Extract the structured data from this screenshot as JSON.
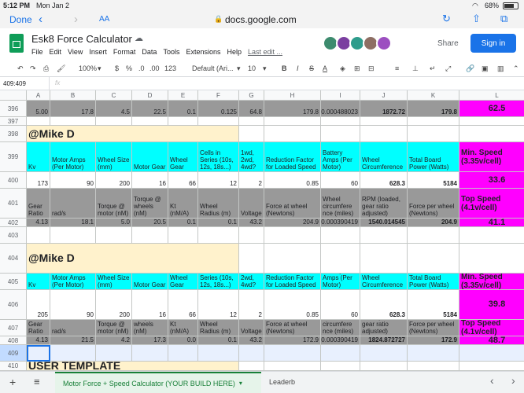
{
  "status": {
    "time": "5:12 PM",
    "date": "Mon Jan 2",
    "battery": "68%"
  },
  "safari": {
    "done": "Done",
    "text_size": "AA",
    "url": "docs.google.com"
  },
  "doc": {
    "title": "Esk8 Force Calculator",
    "menu": [
      "File",
      "Edit",
      "View",
      "Insert",
      "Format",
      "Data",
      "Tools",
      "Extensions",
      "Help"
    ],
    "last_edit": "Last edit ...",
    "share": "Share",
    "sign_in": "Sign in"
  },
  "toolbar": {
    "zoom": "100%",
    "currency": "$",
    "percent": "%",
    "dec_less": ".0",
    "dec_more": ".00",
    "format_more": "123",
    "font": "Default (Ari...",
    "font_size": "10",
    "bold": "B",
    "italic": "I",
    "strike": "S",
    "text_color": "A"
  },
  "formula_bar": {
    "name_box": "409:409",
    "fx": "fx"
  },
  "grid": {
    "columns": [
      "A",
      "B",
      "C",
      "D",
      "E",
      "F",
      "G",
      "H",
      "I",
      "J",
      "K",
      "L"
    ],
    "row_nums": [
      "396",
      "397",
      "398",
      "399",
      "400",
      "401",
      "402",
      "403",
      "404",
      "405",
      "406",
      "407",
      "408",
      "409",
      "410"
    ],
    "r396": [
      "5.00",
      "17.8",
      "4.5",
      "22.5",
      "0.1",
      "0.125",
      "64.8",
      "179.8",
      "0.000488023",
      "1872.72",
      "179.8",
      "62.5"
    ],
    "name1": "@Mike D",
    "name2": "@Mike D",
    "template": "USER TEMPLATE",
    "hdr_a": [
      "Kv",
      "Motor Amps (Per Motor)",
      "Wheel Size (mm)",
      "Motor Gear",
      "Wheel Gear",
      "Cells in Series (10s, 12s, 18s...)",
      "1wd, 2wd, 4wd?",
      "Reduction Factor for Loaded Speed",
      "Battery Amps (Per Motor)",
      "Wheel Circumference",
      "Total Board Power (Watts)",
      "Min. Speed (3.35v/cell)"
    ],
    "val_a1": [
      "173",
      "90",
      "200",
      "16",
      "66",
      "12",
      "2",
      "0.85",
      "60",
      "628.3",
      "5184",
      "33.6"
    ],
    "hdr_b": [
      "Gear Ratio",
      "rad/s",
      "Torque @ motor (nM)",
      "Torque @ wheels (nM)",
      "Kt (nM/A)",
      "Wheel Radius (m)",
      "Voltage",
      "Force at wheel (Newtons)",
      "Wheel circumfere nce (miles)",
      "RPM (loaded, gear ratio adjusted)",
      "Force per wheel (Newtons)",
      "Top Speed (4.1v/cell)"
    ],
    "val_b1": [
      "4.13",
      "18.1",
      "5.0",
      "20.5",
      "0.1",
      "0.1",
      "43.2",
      "204.9",
      "0.000390419",
      "1540.014545",
      "204.9",
      "41.1"
    ],
    "val_a2": [
      "205",
      "90",
      "200",
      "16",
      "66",
      "12",
      "2",
      "0.85",
      "60",
      "628.3",
      "5184",
      "39.8"
    ],
    "val_b2": [
      "4.13",
      "21.5",
      "4.2",
      "17.3",
      "0.0",
      "0.1",
      "43.2",
      "172.9",
      "0.000390419",
      "1824.872727",
      "172.9",
      "48.7"
    ]
  },
  "sheets": {
    "add": "+",
    "list": "≡",
    "active_tab": "Motor Force + Speed Calculator (YOUR BUILD HERE)",
    "next_tab": "Leaderb"
  },
  "colors": {
    "gray": "#999999",
    "cyan": "#00ffff",
    "magenta": "#ff00ff",
    "cream": "#fff2cc",
    "sheets_green": "#0f9d58",
    "accent_blue": "#1a73e8"
  }
}
